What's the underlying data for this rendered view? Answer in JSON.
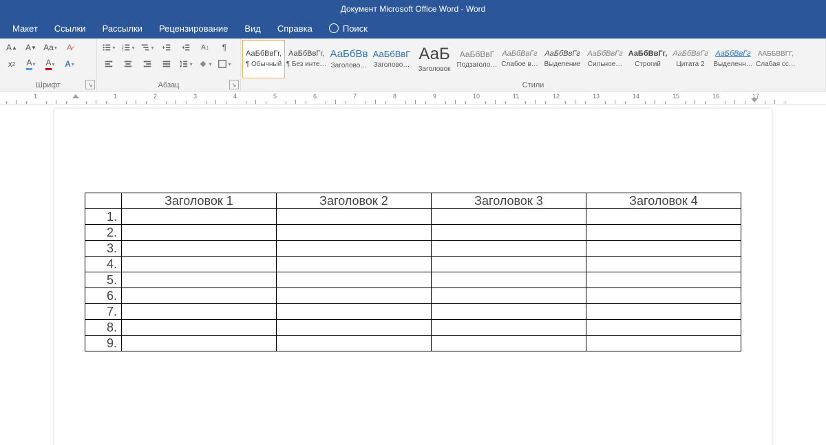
{
  "title": "Документ Microsoft Office Word  -  Word",
  "menu": [
    "Макет",
    "Ссылки",
    "Рассылки",
    "Рецензирование",
    "Вид",
    "Справка"
  ],
  "search_label": "Поиск",
  "ribbon": {
    "group_font": "Шрифт",
    "group_para": "Абзац",
    "group_styles": "Стили"
  },
  "styles": [
    {
      "prev": "АаБбВвГг,",
      "name": "¶ Обычный",
      "style": "font-size:11px"
    },
    {
      "prev": "АаБбВвГг,",
      "name": "¶ Без инте…",
      "style": "font-size:11px"
    },
    {
      "prev": "АаБбВв",
      "name": "Заголово…",
      "style": "font-size:15px;color:#2e74b5"
    },
    {
      "prev": "АаБбВвГ",
      "name": "Заголово…",
      "style": "font-size:13px;color:#2e74b5"
    },
    {
      "prev": "АаБ",
      "name": "Заголовок",
      "style": "font-size:24px"
    },
    {
      "prev": "АаБбВвГ",
      "name": "Подзаголо…",
      "style": "font-size:12px;color:#7f7f7f"
    },
    {
      "prev": "АаБбВвГг",
      "name": "Слабое в…",
      "style": "font-size:11px;color:#7f7f7f;font-style:italic"
    },
    {
      "prev": "АаБбВвГг",
      "name": "Выделение",
      "style": "font-size:11px;font-style:italic"
    },
    {
      "prev": "АаБбВвГг",
      "name": "Сильное…",
      "style": "font-size:11px;color:#7f7f7f;font-style:italic"
    },
    {
      "prev": "АаБбВвГг,",
      "name": "Строгий",
      "style": "font-size:11px;font-weight:bold"
    },
    {
      "prev": "АаБбВвГг",
      "name": "Цитата 2",
      "style": "font-size:11px;color:#7f7f7f;font-style:italic"
    },
    {
      "prev": "АаБбВвГг",
      "name": "Выделенн…",
      "style": "font-size:11px;color:#2e74b5;font-style:italic;text-decoration:underline"
    },
    {
      "prev": "ААББВВГГ,",
      "name": "Слабая сс…",
      "style": "font-size:10px;color:#7f7f7f"
    }
  ],
  "table": {
    "headers": [
      "Заголовок 1",
      "Заголовок 2",
      "Заголовок 3",
      "Заголовок 4"
    ],
    "rows": [
      "1.",
      "2.",
      "3.",
      "4.",
      "5.",
      "6.",
      "7.",
      "8.",
      "9."
    ]
  },
  "ruler": {
    "start": -3,
    "end": 17,
    "pageStart": 0,
    "pageEnd": 17,
    "pxPerCm": 58,
    "leftPad": 110
  }
}
